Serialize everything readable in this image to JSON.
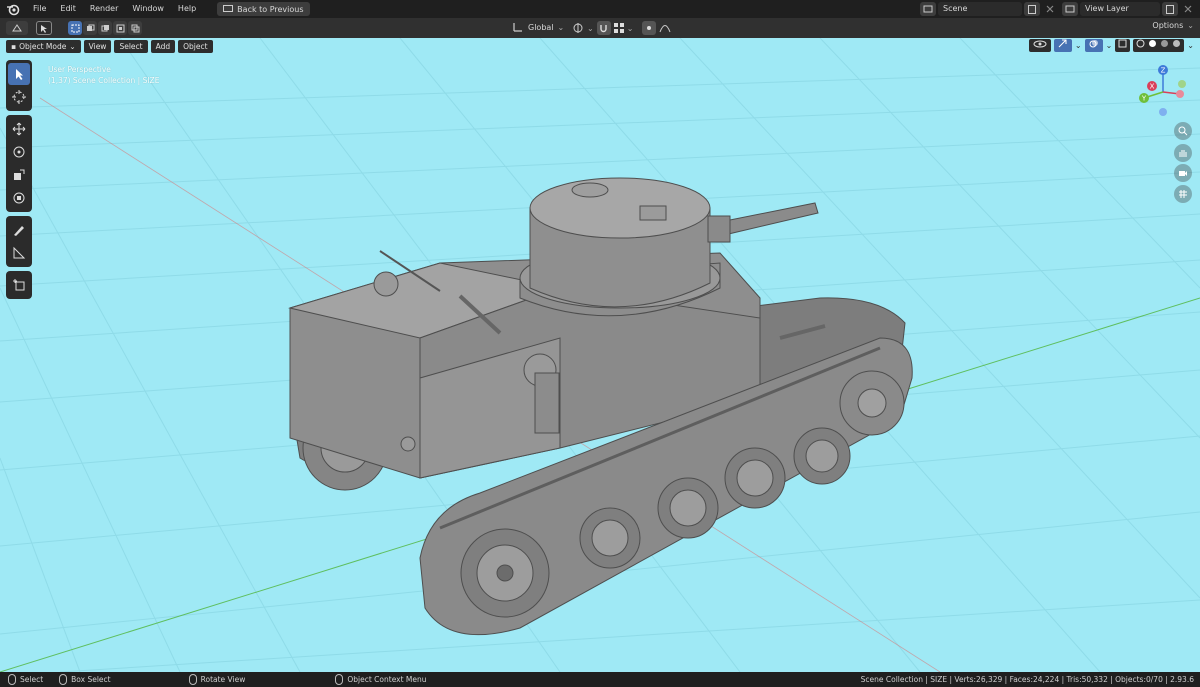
{
  "menu": {
    "items": [
      "File",
      "Edit",
      "Render",
      "Window",
      "Help"
    ],
    "back_label": "Back to Previous"
  },
  "scene": {
    "label": "Scene",
    "view_layer": "View Layer"
  },
  "tool_header": {
    "orientation": "Global",
    "options_label": "Options"
  },
  "viewport_header": {
    "mode": "Object Mode",
    "menus": [
      "View",
      "Select",
      "Add",
      "Object"
    ]
  },
  "overlay": {
    "line1": "User Perspective",
    "line2": "(1,37) Scene Collection | SIZE"
  },
  "gizmo": {
    "x": "X",
    "y": "Y",
    "z": "Z"
  },
  "status": {
    "select": "Select",
    "box_select": "Box Select",
    "rotate_view": "Rotate View",
    "context_menu": "Object Context Menu",
    "stats": "Scene Collection | SIZE | Verts:26,329 | Faces:24,224 | Tris:50,332 | Objects:0/70 | 2.93.6"
  },
  "colors": {
    "viewport_bg": "#9fe9f5",
    "accent": "#4772b3",
    "model": "#8a8a8a"
  }
}
